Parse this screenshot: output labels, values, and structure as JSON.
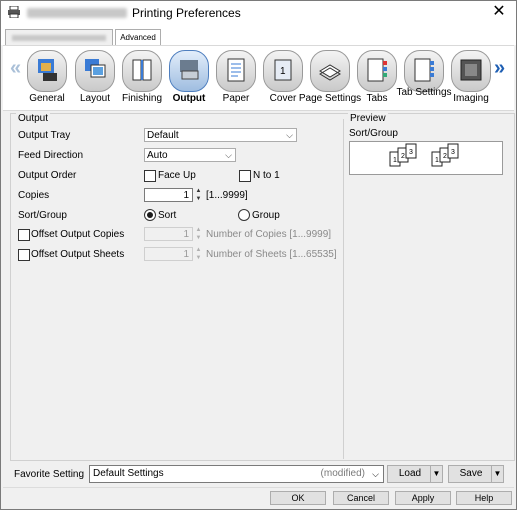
{
  "window": {
    "title": "Printing Preferences"
  },
  "tabs": {
    "advanced": "Advanced"
  },
  "icons": [
    {
      "label": "General"
    },
    {
      "label": "Layout"
    },
    {
      "label": "Finishing"
    },
    {
      "label": "Output"
    },
    {
      "label": "Paper"
    },
    {
      "label": "Cover"
    },
    {
      "label": "Page Settings"
    },
    {
      "label": "Tabs"
    },
    {
      "label": "Tab Settings"
    },
    {
      "label": "Imaging"
    }
  ],
  "nav": {
    "left_arrow": "«",
    "right_arrow": "»"
  },
  "output": {
    "group_title": "Output",
    "output_tray": {
      "label": "Output Tray",
      "value": "Default"
    },
    "feed_direction": {
      "label": "Feed Direction",
      "value": "Auto"
    },
    "output_order": {
      "label": "Output Order",
      "face_up": "Face Up",
      "n_to_1": "N to 1"
    },
    "copies": {
      "label": "Copies",
      "value": "1",
      "range": "[1...9999]"
    },
    "sort_group": {
      "label": "Sort/Group",
      "sort": "Sort",
      "group": "Group"
    },
    "offset_copies": {
      "label": "Offset Output Copies",
      "value": "1",
      "hint": "Number of Copies [1...9999]"
    },
    "offset_sheets": {
      "label": "Offset Output Sheets",
      "value": "1",
      "hint": "Number of Sheets [1...65535]"
    }
  },
  "preview": {
    "group_title": "Preview",
    "label": "Sort/Group",
    "page_numbers": [
      "1",
      "2",
      "3",
      "1",
      "2",
      "3"
    ]
  },
  "favorite": {
    "label": "Favorite Setting",
    "value": "Default Settings",
    "modified": "(modified)",
    "load": "Load",
    "save": "Save"
  },
  "buttons": {
    "ok": "OK",
    "cancel": "Cancel",
    "apply": "Apply",
    "help": "Help"
  },
  "colors": {
    "accent": "#1f5fb3",
    "selected_icon": "#9fbde0"
  }
}
